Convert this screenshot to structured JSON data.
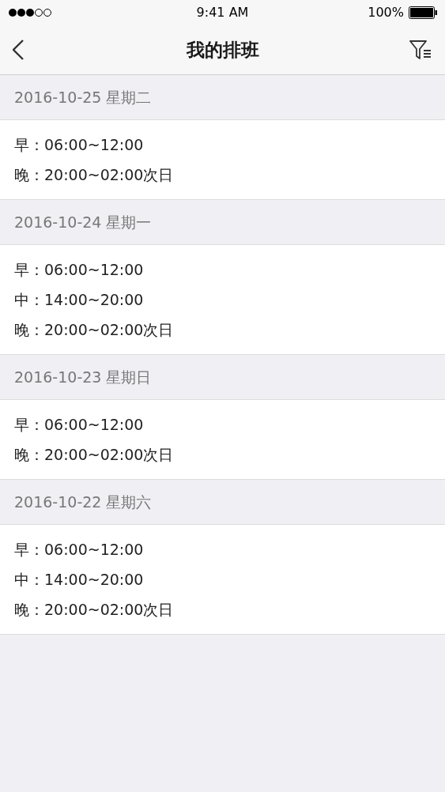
{
  "status_bar": {
    "time": "9:41 AM",
    "battery": "100%"
  },
  "nav": {
    "title": "我的排班"
  },
  "days": [
    {
      "date": "2016-10-25 星期二",
      "shifts": [
        "早：06:00~12:00",
        "晚：20:00~02:00次日"
      ]
    },
    {
      "date": "2016-10-24 星期一",
      "shifts": [
        "早：06:00~12:00",
        "中：14:00~20:00",
        "晚：20:00~02:00次日"
      ]
    },
    {
      "date": "2016-10-23 星期日",
      "shifts": [
        "早：06:00~12:00",
        "晚：20:00~02:00次日"
      ]
    },
    {
      "date": "2016-10-22 星期六",
      "shifts": [
        "早：06:00~12:00",
        "中：14:00~20:00",
        "晚：20:00~02:00次日"
      ]
    }
  ]
}
